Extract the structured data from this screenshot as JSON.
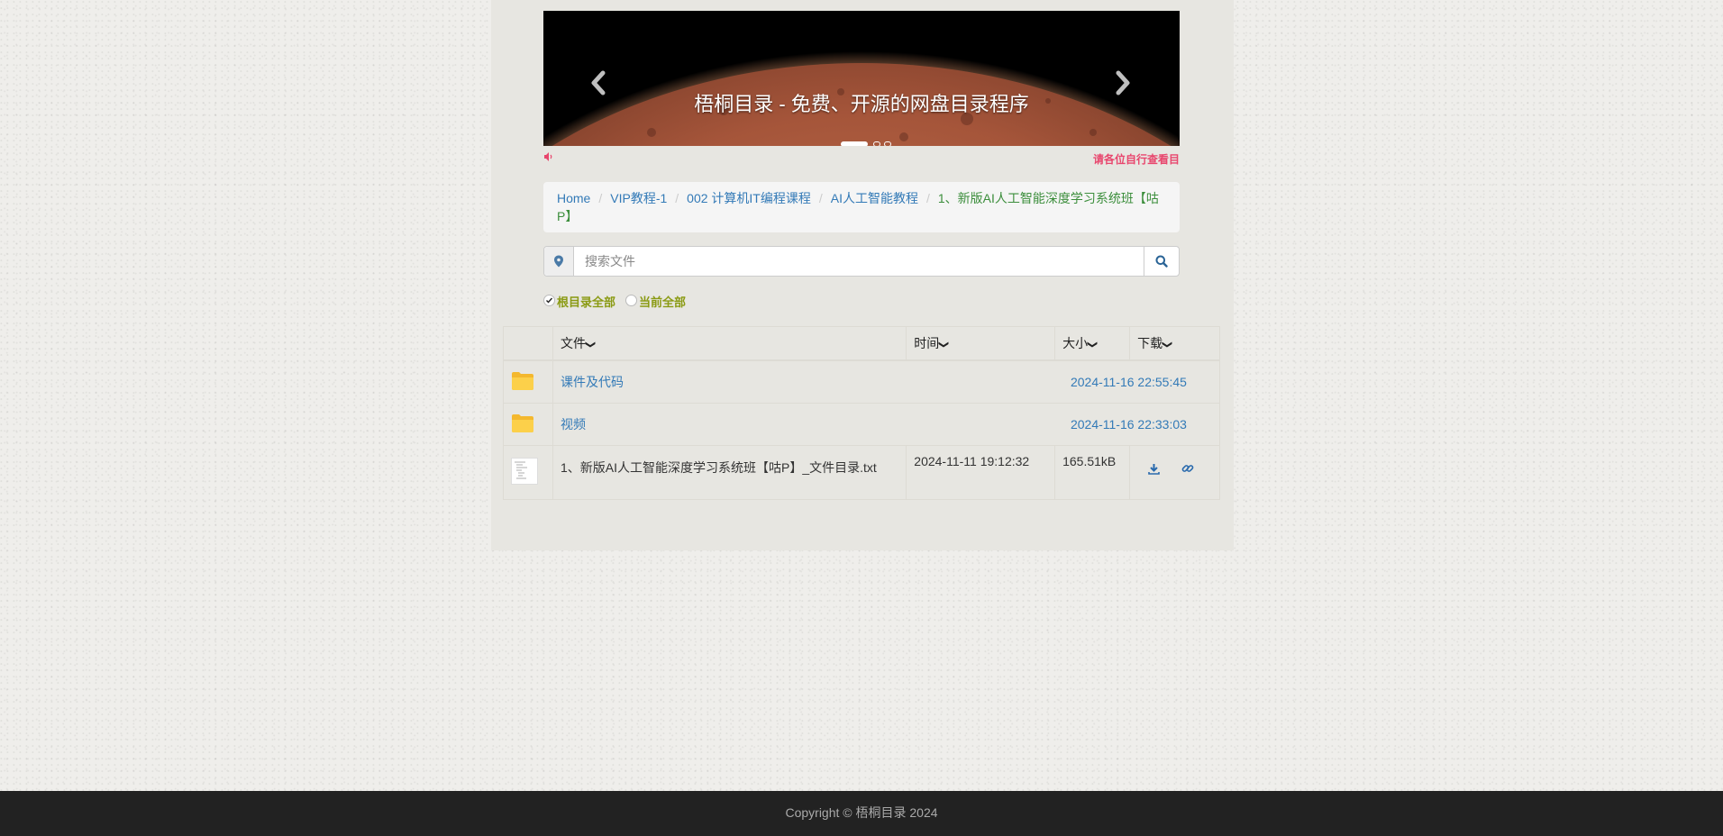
{
  "carousel": {
    "caption": "梧桐目录 - 免费、开源的网盘目录程序",
    "prev_icon": "chevron-left-icon",
    "next_icon": "chevron-right-icon",
    "slide_count": 3,
    "active_slide": 1
  },
  "notice": {
    "icon": "volume-icon",
    "text": "请各位自行查看目",
    "color": "#e8466d"
  },
  "breadcrumb": {
    "items": [
      "Home",
      "VIP教程-1",
      "002 计算机IT编程课程",
      "AI人工智能教程"
    ],
    "current": "1、新版AI人工智能深度学习系统班【咕P】"
  },
  "search": {
    "placeholder": "搜索文件",
    "value": "",
    "left_icon": "map-marker-icon",
    "button_icon": "search-icon"
  },
  "scope": {
    "options": [
      "根目录全部",
      "当前全部"
    ],
    "selected": "根目录全部"
  },
  "table": {
    "headers": {
      "file": "文件",
      "time": "时间",
      "size": "大小",
      "download": "下载"
    },
    "sort_icon": "chevron-down-icon",
    "rows": [
      {
        "type": "folder",
        "icon": "folder-icon",
        "name": "课件及代码",
        "time": "2024-11-16 22:55:45",
        "size": ""
      },
      {
        "type": "folder",
        "icon": "folder-icon",
        "name": "视频",
        "time": "2024-11-16 22:33:03",
        "size": ""
      },
      {
        "type": "file",
        "icon": "txt-file-thumbnail-icon",
        "name": "1、新版AI人工智能深度学习系统班【咕P】_文件目录.txt",
        "time": "2024-11-11 19:12:32",
        "size": "165.51kB",
        "actions": [
          "download-icon",
          "link-icon"
        ]
      }
    ]
  },
  "footer": {
    "text": "Copyright © 梧桐目录 2024"
  }
}
